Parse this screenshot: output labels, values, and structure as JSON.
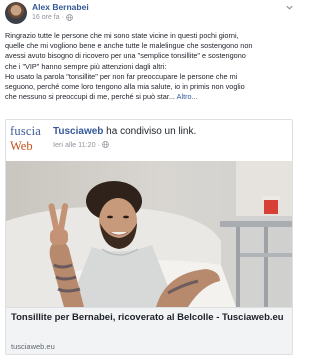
{
  "post": {
    "author": "Alex Bernabei",
    "timestamp": "16 ore fa",
    "separator": "·",
    "privacy_icon": "globe-icon",
    "menu_icon": "chevron-down-icon",
    "text_lines": [
      "Ringrazio tutte le persone che mi sono state vicine in questi pochi giorni,",
      "quelle che mi vogliono bene e anche tutte le malelingue che sostengono non",
      "avessi avuto bisogno di ricovero per una \"semplice tonsillite\" e sostengono",
      "che i \"VIP\" hanno sempre più attenzioni dagli altri:",
      "Ho usato la parola \"tonsillite\" per non far preoccupare le persone che mi",
      "seguono, perché come loro tengono alla mia salute, io in primis non voglio",
      "che nessuno si preoccupi di me, perché si può star..."
    ],
    "see_more": "Altro..."
  },
  "shared": {
    "logo_line1": "fuscia",
    "logo_line2": "Web",
    "page_name": "Tusciaweb",
    "action": "ha condiviso un link.",
    "time": "Ieri alle 11:20",
    "separator": "·",
    "privacy_icon": "globe-icon"
  },
  "link": {
    "title": "Tonsillite per Bernabei, ricoverato al Belcolle - Tusciaweb.eu",
    "domain": "tusciaweb.eu"
  },
  "colors": {
    "link_blue": "#365899",
    "logo_blue": "#3b5b95",
    "logo_orange": "#c8501d",
    "footer_bg": "#f2f3f5"
  }
}
